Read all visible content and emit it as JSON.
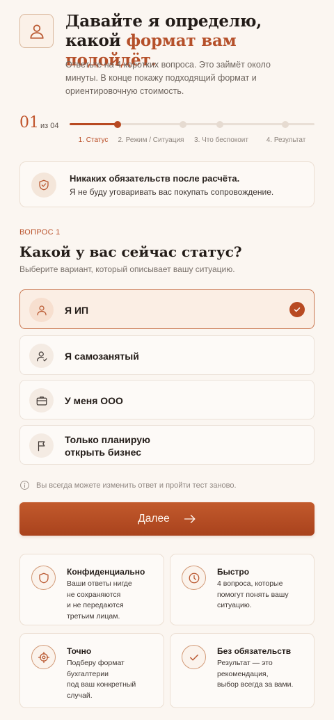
{
  "header": {
    "title_line1": "Давайте я определю,",
    "title_line2_prefix": "какой ",
    "title_line2_accent": "формат вам подойдёт.",
    "subtitle": "Ответьте на 4 коротких вопроса. Это займёт около минуты. В конце покажу подходящий формат и ориентировочную стоимость.",
    "icon": "person-icon"
  },
  "progress": {
    "current": "01",
    "of_label": "из 04",
    "fraction": 0.2,
    "steps": [
      {
        "label": "1. Статус",
        "active": true
      },
      {
        "label": "2. Режим / Ситуация",
        "active": false
      },
      {
        "label": "3. Что беспокоит",
        "active": false
      },
      {
        "label": "4. Результат",
        "active": false
      }
    ]
  },
  "notice": {
    "title": "Никаких обязательств после расчёта.",
    "text": "Я не буду уговаривать вас покупать сопровождение.",
    "icon": "shield-icon"
  },
  "question": {
    "kicker": "ВОПРОС 1",
    "title": "Какой у вас сейчас статус?",
    "subtitle": "Выберите вариант, который описывает вашу ситуацию.",
    "options": [
      {
        "label": "Я ИП",
        "icon": "person-icon",
        "selected": true
      },
      {
        "label": "Я самозанятый",
        "icon": "user-check-icon",
        "selected": false
      },
      {
        "label": "У меня ООО",
        "icon": "briefcase-icon",
        "selected": false
      },
      {
        "label": "Только планирую\nоткрыть бизнес",
        "icon": "flag-icon",
        "selected": false
      }
    ]
  },
  "hint": "Вы всегда можете изменить ответ и пройти тест заново.",
  "cta": {
    "label": "Далее"
  },
  "colors": {
    "accent": "#b84a22",
    "background": "#fbf6f1"
  },
  "features": [
    {
      "title": "Конфиденциально",
      "text": "Ваши ответы нигде\nне сохраняются\nи не передаются\nтретьим лицам.",
      "icon": "shield-icon"
    },
    {
      "title": "Быстро",
      "text": "4 вопроса, которые\nпомогут понять вашу\nситуацию.",
      "icon": "clock-icon"
    },
    {
      "title": "Точно",
      "text": "Подберу формат\nбухгалтерии\nпод ваш конкретный\nслучай.",
      "icon": "target-icon"
    },
    {
      "title": "Без обязательств",
      "text": "Результат — это\nрекомендация,\nвыбор всегда за вами.",
      "icon": "check-circle-icon"
    }
  ]
}
